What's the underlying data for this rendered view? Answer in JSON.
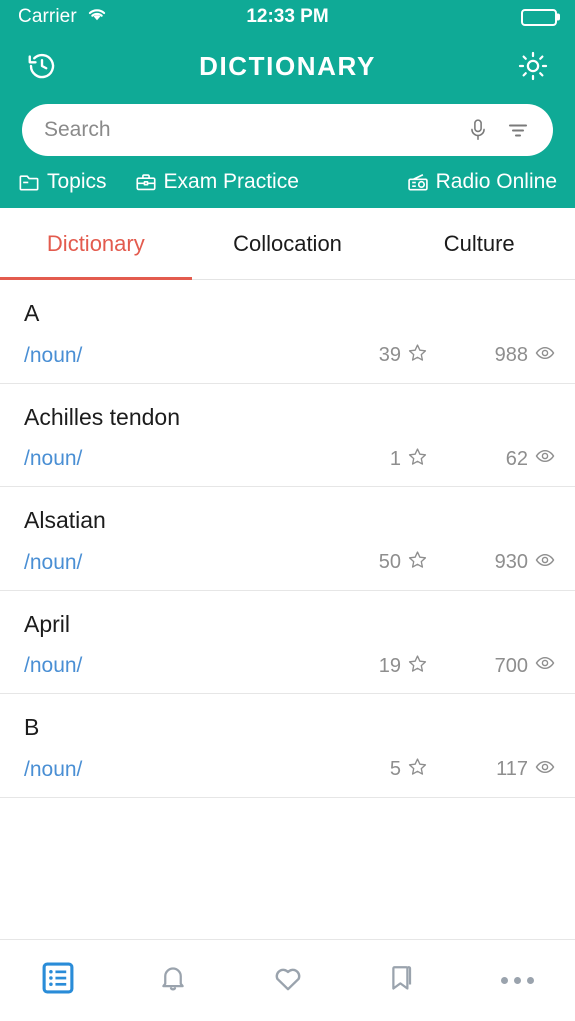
{
  "status_bar": {
    "carrier": "Carrier",
    "wifi_icon": "wifi-icon",
    "time": "12:33 PM",
    "battery_icon": "battery-full-icon"
  },
  "header": {
    "title": "DICTIONARY",
    "left_icon": "history-icon",
    "right_icon": "brightness-icon",
    "background_color": "#0FAA96"
  },
  "search": {
    "placeholder": "Search",
    "value": "",
    "mic_icon": "microphone-icon",
    "filter_icon": "filter-icon"
  },
  "quick_links": [
    {
      "label": "Topics",
      "icon": "folder-icon"
    },
    {
      "label": "Exam Practice",
      "icon": "briefcase-icon"
    },
    {
      "label": "Radio Online",
      "icon": "radio-icon"
    }
  ],
  "tabs": {
    "active_color": "#E35B4E",
    "items": [
      {
        "label": "Dictionary",
        "active": true
      },
      {
        "label": "Collocation",
        "active": false
      },
      {
        "label": "Culture",
        "active": false
      }
    ]
  },
  "word_list": {
    "pos_color": "#4A8FD4",
    "rows": [
      {
        "term": "A",
        "pos": "/noun/",
        "favorites": "39",
        "views": "988"
      },
      {
        "term": "Achilles tendon",
        "pos": "/noun/",
        "favorites": "1",
        "views": "62"
      },
      {
        "term": "Alsatian",
        "pos": "/noun/",
        "favorites": "50",
        "views": "930"
      },
      {
        "term": "April",
        "pos": "/noun/",
        "favorites": "19",
        "views": "700"
      },
      {
        "term": "B",
        "pos": "/noun/",
        "favorites": "5",
        "views": "117"
      }
    ],
    "favorite_icon": "star-icon",
    "views_icon": "eye-icon"
  },
  "bottom_bar": {
    "active_color": "#2A8CD8",
    "inactive_color": "#9aa3ad",
    "items": [
      {
        "name": "list-icon",
        "active": true
      },
      {
        "name": "bell-icon",
        "active": false
      },
      {
        "name": "heart-icon",
        "active": false
      },
      {
        "name": "bookmark-icon",
        "active": false
      },
      {
        "name": "more-icon",
        "active": false
      }
    ]
  }
}
